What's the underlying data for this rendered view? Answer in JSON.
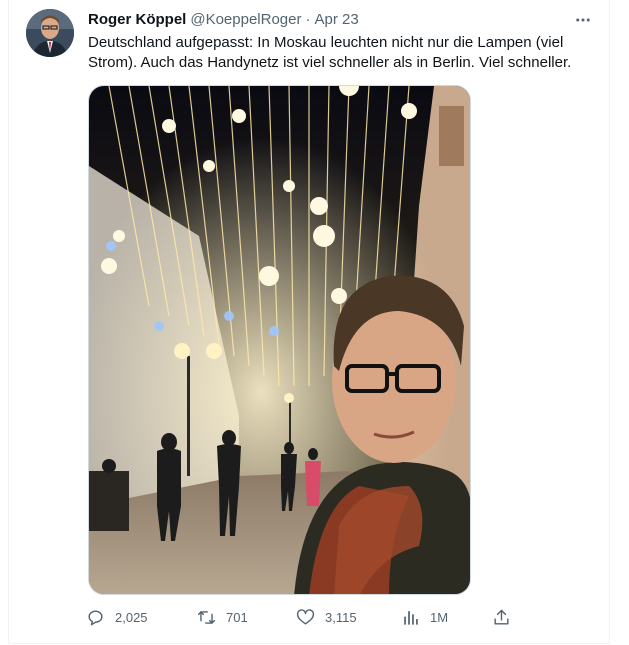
{
  "tweet": {
    "author_name": "Roger Köppel",
    "handle": "@KoeppelRoger",
    "separator": "·",
    "date": "Apr 23",
    "text_line1": "Deutschland aufgepasst: In Moskau leuchten nicht nur die Lampen (viel",
    "text_line2": "Strom). Auch das Handynetz ist viel schneller als in Berlin. Viel schneller.",
    "more_label": "···"
  },
  "actions": {
    "replies": "2,025",
    "retweets": "701",
    "likes": "3,115",
    "views": "1M"
  },
  "icons": {
    "more": "more-horizontal-icon",
    "reply": "reply-icon",
    "retweet": "retweet-icon",
    "like": "heart-icon",
    "views": "analytics-icon",
    "share": "share-icon"
  },
  "colors": {
    "text_primary": "#0f1419",
    "text_secondary": "#536471",
    "border": "#cfd9de"
  }
}
